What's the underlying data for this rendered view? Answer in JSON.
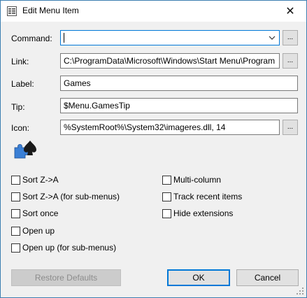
{
  "window": {
    "title": "Edit Menu Item",
    "close_glyph": "✕"
  },
  "form": {
    "command": {
      "label": "Command:",
      "value": "",
      "dropdown_icon": "chevron-down-icon"
    },
    "link": {
      "label": "Link:",
      "value": "C:\\ProgramData\\Microsoft\\Windows\\Start Menu\\Program"
    },
    "label": {
      "label": "Label:",
      "value": "Games"
    },
    "tip": {
      "label": "Tip:",
      "value": "$Menu.GamesTip"
    },
    "icon": {
      "label": "Icon:",
      "value": "%SystemRoot%\\System32\\imageres.dll, 14"
    },
    "browse_label": "..."
  },
  "options": {
    "left": [
      {
        "label": "Sort Z->A",
        "checked": false
      },
      {
        "label": "Sort Z->A (for sub-menus)",
        "checked": false
      },
      {
        "label": "Sort once",
        "checked": false
      },
      {
        "label": "Open up",
        "checked": false
      },
      {
        "label": "Open up (for sub-menus)",
        "checked": false
      }
    ],
    "right": [
      {
        "label": "Multi-column",
        "checked": false
      },
      {
        "label": "Track recent items",
        "checked": false
      },
      {
        "label": "Hide extensions",
        "checked": false
      }
    ]
  },
  "buttons": {
    "restore": "Restore Defaults",
    "ok": "OK",
    "cancel": "Cancel"
  },
  "colors": {
    "accent": "#0078d7",
    "window_bg": "#f0f0f0"
  }
}
